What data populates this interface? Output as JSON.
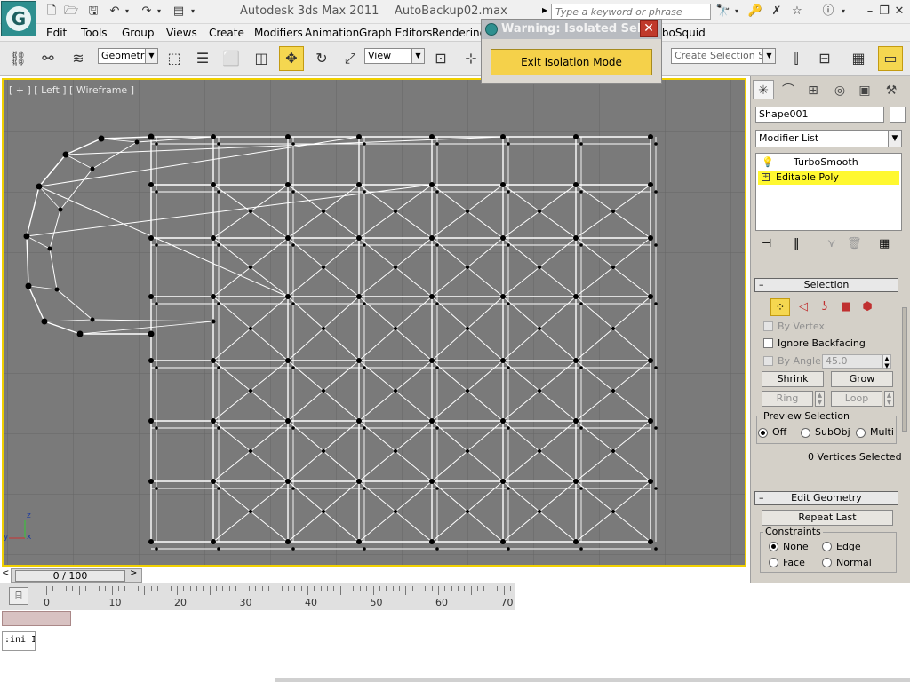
{
  "titlebar": {
    "app_name": "Autodesk 3ds Max  2011",
    "file_name": "AutoBackup02.max",
    "search_placeholder": "Type a keyword or phrase"
  },
  "menus": [
    "Edit",
    "Tools",
    "Group",
    "Views",
    "Create",
    "Modifiers",
    "Animation",
    "Graph Editors",
    "Rendering",
    "rboSquid"
  ],
  "toolbar": {
    "selection_filter": "Geometry",
    "reference_coord": "View",
    "named_selection": "Create Selection Se"
  },
  "dialog": {
    "title": "Warning: Isolated Sel...",
    "button": "Exit Isolation Mode"
  },
  "viewport": {
    "label": "[ + ] [ Left ] [ Wireframe ]",
    "axis_z": "z",
    "axis_y": "y",
    "axis_x": "x"
  },
  "command_panel": {
    "object_name": "Shape001",
    "modifier_list": "Modifier List",
    "stack": [
      "TurboSmooth",
      "Editable Poly"
    ],
    "selection_rollout": "Selection",
    "by_vertex": "By Vertex",
    "ignore_backfacing": "Ignore Backfacing",
    "by_angle": "By Angle:",
    "angle_value": "45.0",
    "shrink": "Shrink",
    "grow": "Grow",
    "ring": "Ring",
    "loop": "Loop",
    "preview_selection": "Preview Selection",
    "preview_off": "Off",
    "preview_subobj": "SubObj",
    "preview_multi": "Multi",
    "selection_status": "0 Vertices Selected",
    "edit_geometry_rollout": "Edit Geometry",
    "repeat_last": "Repeat Last",
    "constraints": "Constraints",
    "c_none": "None",
    "c_edge": "Edge",
    "c_face": "Face",
    "c_normal": "Normal"
  },
  "timeline": {
    "frame": "0 / 100",
    "ticks": [
      "0",
      "10",
      "20",
      "30",
      "40",
      "50",
      "60",
      "70"
    ]
  },
  "maxscript": {
    "text": ":ini I"
  }
}
